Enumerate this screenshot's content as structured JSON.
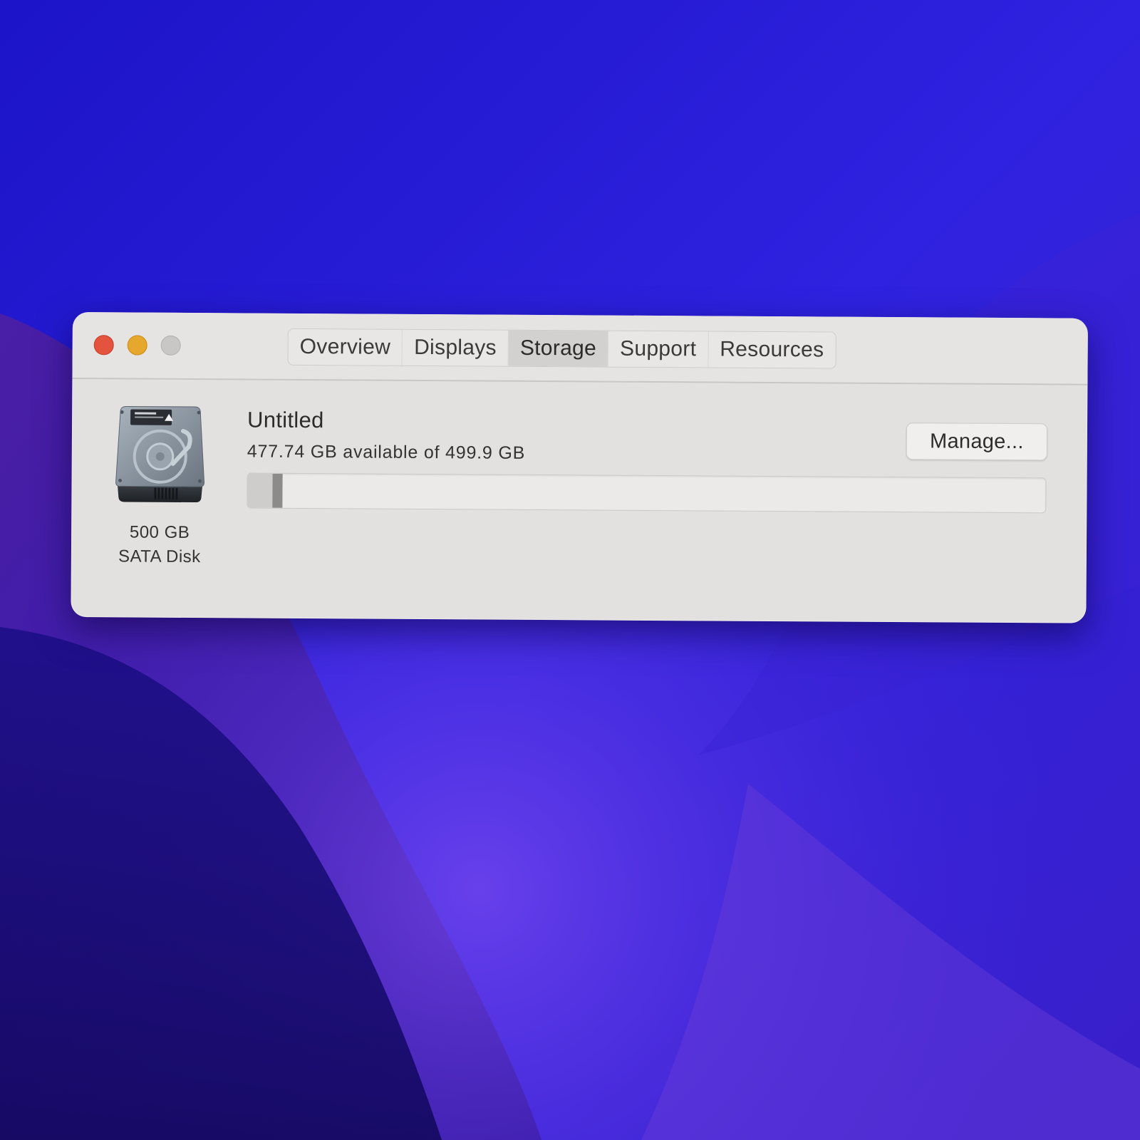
{
  "window": {
    "tabs": [
      {
        "label": "Overview",
        "active": false
      },
      {
        "label": "Displays",
        "active": false
      },
      {
        "label": "Storage",
        "active": true
      },
      {
        "label": "Support",
        "active": false
      },
      {
        "label": "Resources",
        "active": false
      }
    ]
  },
  "disk": {
    "capacity_label": "500 GB",
    "type_label": "SATA Disk",
    "icon": "hard-drive-icon"
  },
  "volume": {
    "name": "Untitled",
    "availability": "477.74 GB available of 499.9 GB",
    "used_fraction": 0.044
  },
  "actions": {
    "manage_label": "Manage..."
  },
  "colors": {
    "close": "#e4533d",
    "minimize": "#e5a72c",
    "zoom_inactive": "#c9c7c6",
    "window_bg": "#e3e1e0",
    "wallpaper_primary": "#2a1cd8"
  }
}
